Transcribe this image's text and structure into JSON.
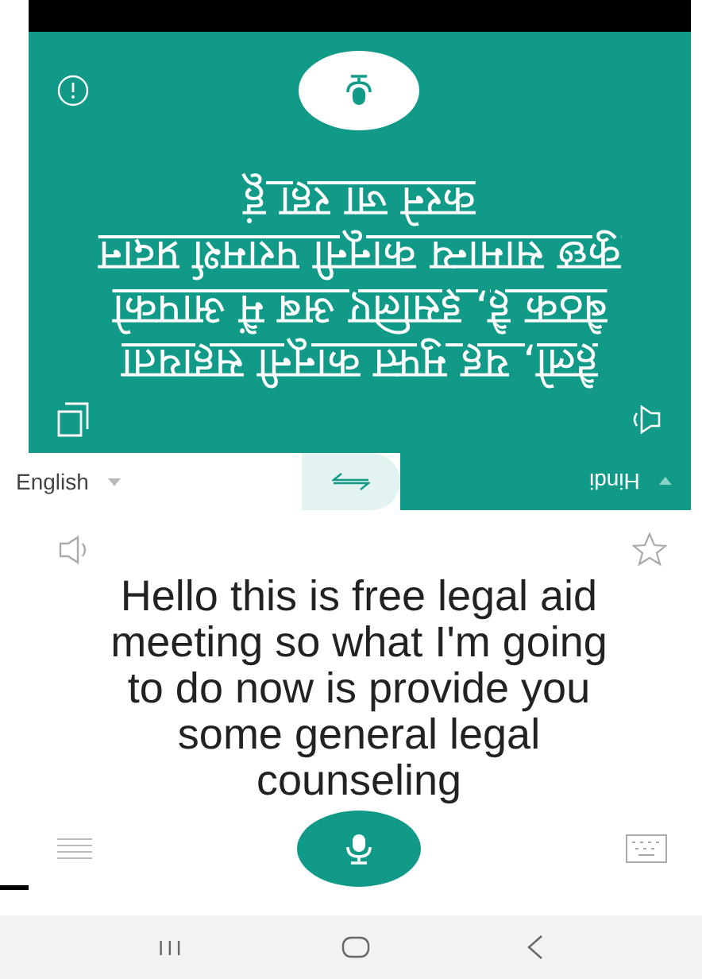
{
  "translation_panel": {
    "text": "हैलो, यह मुफ्त कानूनी सहायता बैठक है, इसलिए अब मैं आपको कुछ सामान्य कानूनी परामर्श प्रदान करने जा रहा हूं"
  },
  "language_bar": {
    "source": "English",
    "target": "Hindi"
  },
  "transcript_panel": {
    "text": "Hello this is free legal aid meeting so what I'm going to do now is provide you some general legal counseling"
  },
  "nav_bar": {
    "recents": "III"
  }
}
